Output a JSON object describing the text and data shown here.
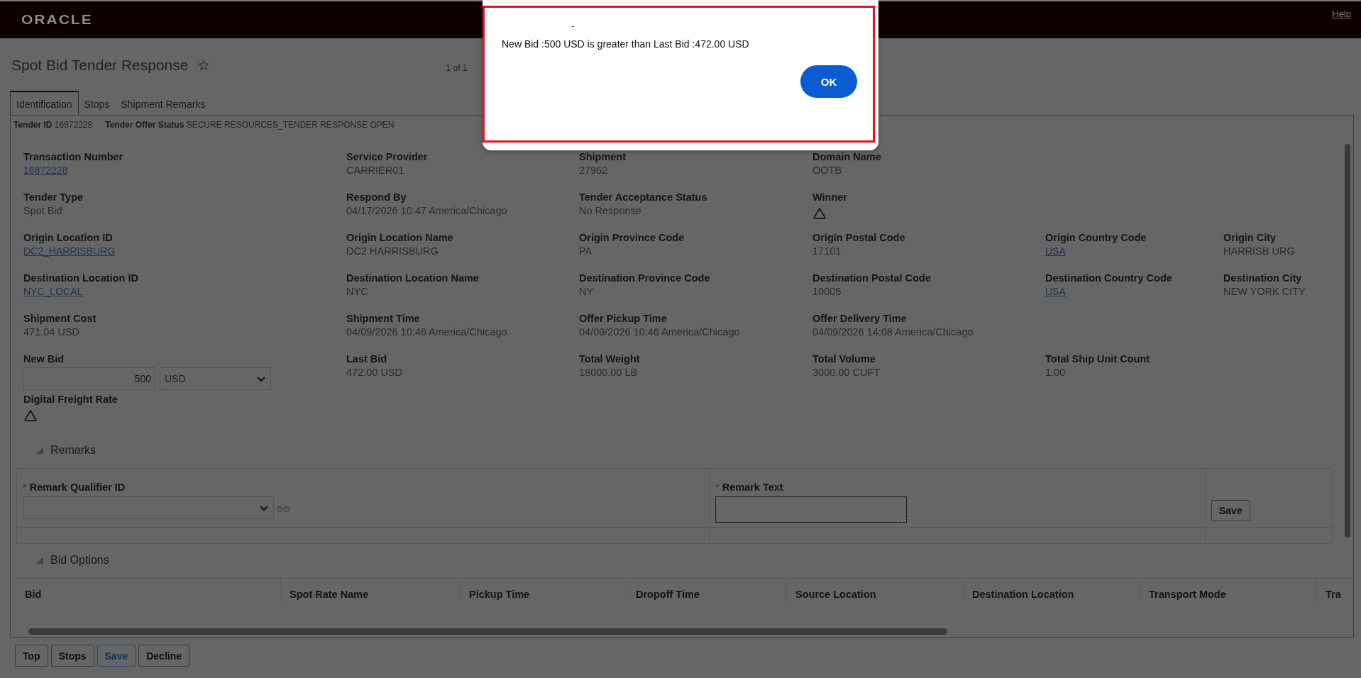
{
  "header": {
    "logo": "ORACLE",
    "help_link": "Help"
  },
  "page": {
    "title": "Spot Bid Tender Response",
    "favorite": false,
    "pager": "1 of 1"
  },
  "tabs": [
    {
      "label": "Identification",
      "selected": true
    },
    {
      "label": "Stops",
      "selected": false
    },
    {
      "label": "Shipment Remarks",
      "selected": false
    }
  ],
  "summary": [
    {
      "label": "Tender ID",
      "value": "16872228"
    },
    {
      "label": "Tender Offer Status",
      "value": "SECURE RESOURCES_TENDER RESPONSE OPEN"
    }
  ],
  "field_rows": [
    {
      "fields": [
        {
          "kind": "link",
          "label": "Transaction Number",
          "value": "16872228"
        },
        {
          "kind": "text",
          "label": "Service Provider",
          "value": "CARRIER01"
        },
        {
          "kind": "text",
          "label": "Shipment",
          "value": "27962"
        },
        {
          "kind": "text",
          "label": "Domain Name",
          "value": "OOTB"
        }
      ]
    },
    {
      "fields": [
        {
          "kind": "text",
          "label": "Tender Type",
          "value": "Spot Bid"
        },
        {
          "kind": "text",
          "label": "Respond By",
          "value": "04/17/2026 10:47 America/Chicago"
        },
        {
          "kind": "text",
          "label": "Tender Acceptance Status",
          "value": "No Response"
        },
        {
          "kind": "icon",
          "label": "Winner"
        }
      ]
    },
    {
      "fields": [
        {
          "kind": "link",
          "label": "Origin Location ID",
          "value": "DC2_HARRISBURG"
        },
        {
          "kind": "text",
          "label": "Origin Location Name",
          "value": "DC2 HARRISBURG"
        },
        {
          "kind": "text",
          "label": "Origin Province Code",
          "value": "PA"
        },
        {
          "kind": "text",
          "label": "Origin Postal Code",
          "value": "17101"
        },
        {
          "kind": "link",
          "label": "Origin Country Code",
          "value": "USA"
        },
        {
          "kind": "text",
          "label": "Origin City",
          "value": "HARRISB URG"
        }
      ]
    },
    {
      "fields": [
        {
          "kind": "link",
          "label": "Destination Location ID",
          "value": "NYC_LOCAL"
        },
        {
          "kind": "text",
          "label": "Destination Location Name",
          "value": "NYC"
        },
        {
          "kind": "text",
          "label": "Destination Province Code",
          "value": "NY"
        },
        {
          "kind": "text",
          "label": "Destination Postal Code",
          "value": "10005"
        },
        {
          "kind": "link",
          "label": "Destination Country Code",
          "value": "USA"
        },
        {
          "kind": "text",
          "label": "Destination City",
          "value": "NEW YORK CITY"
        }
      ]
    },
    {
      "fields": [
        {
          "kind": "text",
          "label": "Shipment Cost",
          "value": "471.04 USD"
        },
        {
          "kind": "text",
          "label": "Shipment Time",
          "value": "04/09/2026 10:46 America/Chicago"
        },
        {
          "kind": "text",
          "label": "Offer Pickup Time",
          "value": "04/09/2026 10:46 America/Chicago"
        },
        {
          "kind": "text",
          "label": "Offer Delivery Time",
          "value": "04/09/2026 14:08 America/Chicago"
        }
      ]
    },
    {
      "fields": [
        {
          "kind": "bid",
          "label": "New Bid",
          "value": "500",
          "currency": "USD"
        },
        {
          "kind": "text",
          "label": "Last Bid",
          "value": "472.00 USD"
        },
        {
          "kind": "text",
          "label": "Total Weight",
          "value": "18000.00 LB"
        },
        {
          "kind": "text",
          "label": "Total Volume",
          "value": "3000.00 CUFT"
        },
        {
          "kind": "text",
          "label": "Total Ship Unit Count",
          "value": "1.00"
        }
      ]
    },
    {
      "fields": [
        {
          "kind": "icon",
          "label": "Digital Freight Rate"
        }
      ]
    }
  ],
  "remarks": {
    "title": "Remarks",
    "expanded": true,
    "required_mark": "*",
    "qualifier_label": "Remark Qualifier ID",
    "text_label": "Remark Text",
    "save_button": "Save"
  },
  "bid_options": {
    "title": "Bid Options",
    "expanded": true,
    "columns": [
      "Bid",
      "Spot Rate Name",
      "Pickup Time",
      "Dropoff Time",
      "Source Location",
      "Destination Location",
      "Transport Mode",
      "Tra"
    ]
  },
  "footer_buttons": [
    {
      "label": "Top",
      "kind": "default"
    },
    {
      "label": "Stops",
      "kind": "default"
    },
    {
      "label": "Save",
      "kind": "primary"
    },
    {
      "label": "Decline",
      "kind": "default"
    }
  ],
  "dialog": {
    "title": "-",
    "message": "New Bid :500 USD is greater than Last Bid :472.00 USD",
    "ok_button": "OK"
  }
}
